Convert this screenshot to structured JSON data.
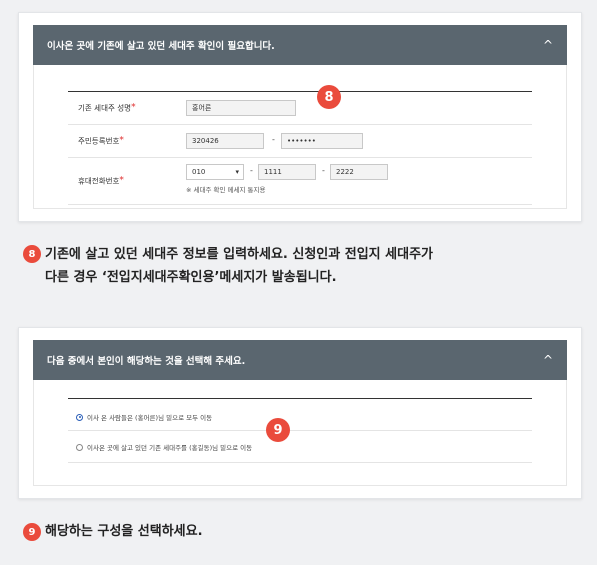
{
  "panel1": {
    "title": "이사온 곳에 기존에 살고 있던 세대주 확인이 필요합니다.",
    "chevron": "^",
    "fields": {
      "name": {
        "label": "기존 세대주 성명",
        "value": "홍어른"
      },
      "rrn": {
        "label": "주민등록번호",
        "front": "320426",
        "dash": "-",
        "back": "•••••••"
      },
      "phone": {
        "label": "휴대전화번호",
        "prefix": "010",
        "dash1": "-",
        "mid": "1111",
        "dash2": "-",
        "last": "2222",
        "note": "※ 세대주 확인 메세지 통지용"
      },
      "required_mark": "*"
    }
  },
  "step8": {
    "number": "8",
    "line1": "기존에 살고 있던 세대주 정보를 입력하세요. 신청인과 전입지 세대주가",
    "line2": "다른 경우 ‘전입지세대주확인용’메세지가 발송됩니다."
  },
  "panel2": {
    "title": "다음 중에서 본인이 해당하는 것을 선택해 주세요.",
    "chevron": "^",
    "options": [
      {
        "label": "이사 온 사람들은 (홍어른)님 밑으로 모두 이동",
        "selected": true
      },
      {
        "label": "이사온 곳에 살고 있던 기존 세대주를 (홍길동)님 밑으로 이동",
        "selected": false
      }
    ]
  },
  "step9": {
    "number": "9",
    "line1": "해당하는 구성을 선택하세요."
  },
  "colors": {
    "header_bg": "#5a666f",
    "badge": "#ea4b3c",
    "required": "#e03030",
    "radio_selected": "#2b5fb8"
  }
}
